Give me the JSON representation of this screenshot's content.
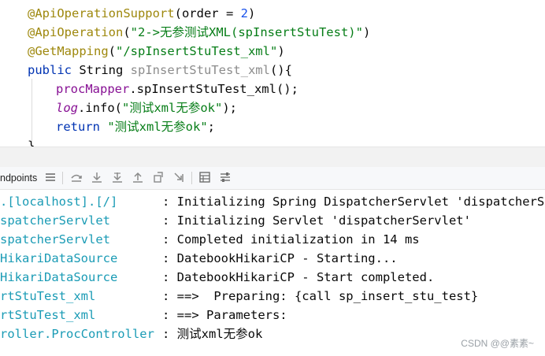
{
  "editor": {
    "line1": {
      "ann": "@ApiOperationSupport",
      "open": "(order = ",
      "num": "2",
      "close": ")"
    },
    "line2": {
      "ann": "@ApiOperation",
      "open": "(",
      "str": "\"2->无参测试XML(spInsertStuTest)\"",
      "close": ")"
    },
    "line3": {
      "ann": "@GetMapping",
      "open": "(",
      "str": "\"/spInsertStuTest_xml\"",
      "close": ")"
    },
    "line4": {
      "kw": "public",
      "type": " String ",
      "name": "spInsertStuTest_xml",
      "rest": "(){"
    },
    "line5": {
      "obj": "procMapper",
      "call": ".spInsertStuTest_xml();"
    },
    "line6": {
      "obj": "log",
      "call": ".info(",
      "str": "\"测试xml无参ok\"",
      "end": ");"
    },
    "line7": {
      "kw": "return",
      "str": " \"测试xml无参ok\"",
      "end": ";"
    },
    "line8": "}"
  },
  "toolbar": {
    "tab_label": "ndpoints",
    "icons": [
      "menu-icon",
      "step-over-icon",
      "step-into-icon",
      "force-step-into-icon",
      "step-out-icon",
      "drop-frame-icon",
      "run-to-cursor-icon",
      "evaluate-icon",
      "settings-icon"
    ]
  },
  "console": {
    "rows": [
      {
        "logger": ".[localhost].[/]",
        "message": ": Initializing Spring DispatcherServlet 'dispatcherServ"
      },
      {
        "logger": "spatcherServlet",
        "message": ": Initializing Servlet 'dispatcherServlet'"
      },
      {
        "logger": "spatcherServlet",
        "message": ": Completed initialization in 14 ms"
      },
      {
        "logger": "HikariDataSource",
        "message": ": DatebookHikariCP - Starting..."
      },
      {
        "logger": "HikariDataSource",
        "message": ": DatebookHikariCP - Start completed."
      },
      {
        "logger": "rtStuTest_xml",
        "message": ": ==>  Preparing: {call sp_insert_stu_test}"
      },
      {
        "logger": "rtStuTest_xml",
        "message": ": ==> Parameters:"
      },
      {
        "logger": "roller.ProcController",
        "message": ": 测试xml无参ok"
      }
    ]
  },
  "watermark": "CSDN @@素素~"
}
